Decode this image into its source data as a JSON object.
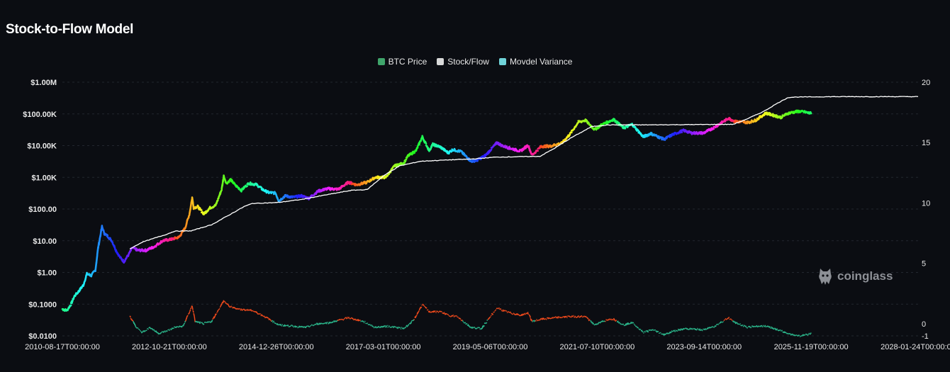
{
  "header": {
    "title": "Stock-to-Flow Model"
  },
  "legend": [
    {
      "label": "BTC Price",
      "color": "#3fa56b"
    },
    {
      "label": "Stock/Flow",
      "color": "#d9d9d9"
    },
    {
      "label": "Movdel Variance",
      "color": "#6fd3d8"
    }
  ],
  "watermark": {
    "text": "coinglass"
  },
  "chart_data": {
    "type": "line",
    "title": "Stock-to-Flow Model",
    "y_left": {
      "scale": "log",
      "ticks": [
        "$1.00M",
        "$100.00K",
        "$10.00K",
        "$1.00K",
        "$100.00",
        "$10.00",
        "$1.00",
        "$0.1000",
        "$0.0100"
      ],
      "range": [
        0.01,
        1000000
      ]
    },
    "y_right": {
      "ticks": [
        "20",
        "15",
        "10",
        "5",
        "0",
        "-1"
      ],
      "range": [
        -1,
        20
      ]
    },
    "x_ticks": [
      "2010-08-17T00:00:00",
      "2012-10-21T00:00:00",
      "2014-12-26T00:00:00",
      "2017-03-01T00:00:00",
      "2019-05-06T00:00:00",
      "2021-07-10T00:00:00",
      "2023-09-14T00:00:00",
      "2025-11-19T00:00:00",
      "2028-01-24T00:00:00"
    ],
    "x_range": [
      "2010-08-17",
      "2028-01-24"
    ],
    "grid": true,
    "legend_position": "top-center",
    "series": [
      {
        "name": "BTC Price",
        "axis": "left",
        "points": [
          [
            "2010-08-17",
            0.07
          ],
          [
            "2010-09-20",
            0.063
          ],
          [
            "2010-10-20",
            0.1
          ],
          [
            "2010-11-15",
            0.18
          ],
          [
            "2010-12-15",
            0.25
          ],
          [
            "2011-01-20",
            0.4
          ],
          [
            "2011-02-15",
            0.9
          ],
          [
            "2011-03-20",
            0.8
          ],
          [
            "2011-04-20",
            1.2
          ],
          [
            "2011-05-10",
            6
          ],
          [
            "2011-06-08",
            28
          ],
          [
            "2011-06-25",
            17
          ],
          [
            "2011-07-20",
            14
          ],
          [
            "2011-08-20",
            10
          ],
          [
            "2011-09-20",
            5
          ],
          [
            "2011-10-20",
            3
          ],
          [
            "2011-11-18",
            2.2
          ],
          [
            "2011-12-20",
            3.5
          ],
          [
            "2012-01-20",
            6
          ],
          [
            "2012-03-01",
            5
          ],
          [
            "2012-05-01",
            5
          ],
          [
            "2012-07-01",
            6.5
          ],
          [
            "2012-09-01",
            10
          ],
          [
            "2012-11-01",
            11
          ],
          [
            "2013-01-01",
            13
          ],
          [
            "2013-02-15",
            25
          ],
          [
            "2013-03-20",
            70
          ],
          [
            "2013-04-09",
            230
          ],
          [
            "2013-04-20",
            110
          ],
          [
            "2013-05-20",
            120
          ],
          [
            "2013-07-05",
            70
          ],
          [
            "2013-08-20",
            110
          ],
          [
            "2013-10-01",
            130
          ],
          [
            "2013-11-15",
            420
          ],
          [
            "2013-11-30",
            1100
          ],
          [
            "2013-12-20",
            650
          ],
          [
            "2014-01-20",
            850
          ],
          [
            "2014-02-25",
            560
          ],
          [
            "2014-04-10",
            390
          ],
          [
            "2014-06-05",
            650
          ],
          [
            "2014-08-01",
            590
          ],
          [
            "2014-09-20",
            400
          ],
          [
            "2014-11-01",
            330
          ],
          [
            "2014-12-20",
            320
          ],
          [
            "2015-01-14",
            180
          ],
          [
            "2015-03-01",
            260
          ],
          [
            "2015-05-01",
            235
          ],
          [
            "2015-07-01",
            260
          ],
          [
            "2015-08-25",
            220
          ],
          [
            "2015-11-05",
            370
          ],
          [
            "2016-01-10",
            440
          ],
          [
            "2016-04-01",
            420
          ],
          [
            "2016-06-15",
            700
          ],
          [
            "2016-08-15",
            580
          ],
          [
            "2016-11-01",
            700
          ],
          [
            "2017-01-01",
            1000
          ],
          [
            "2017-03-20",
            1000
          ],
          [
            "2017-05-25",
            2300
          ],
          [
            "2017-08-01",
            2800
          ],
          [
            "2017-09-01",
            4700
          ],
          [
            "2017-11-01",
            7000
          ],
          [
            "2017-12-17",
            19000
          ],
          [
            "2018-02-06",
            7000
          ],
          [
            "2018-03-05",
            11000
          ],
          [
            "2018-05-01",
            9000
          ],
          [
            "2018-06-28",
            5900
          ],
          [
            "2018-08-01",
            7500
          ],
          [
            "2018-10-01",
            6500
          ],
          [
            "2018-12-15",
            3200
          ],
          [
            "2019-02-01",
            3500
          ],
          [
            "2019-04-03",
            5000
          ],
          [
            "2019-06-26",
            12500
          ],
          [
            "2019-08-01",
            10000
          ],
          [
            "2019-10-01",
            8300
          ],
          [
            "2019-12-17",
            6700
          ],
          [
            "2020-02-12",
            10300
          ],
          [
            "2020-03-13",
            5000
          ],
          [
            "2020-05-20",
            9500
          ],
          [
            "2020-07-25",
            9600
          ],
          [
            "2020-10-20",
            12000
          ],
          [
            "2020-12-20",
            23000
          ],
          [
            "2021-02-20",
            55000
          ],
          [
            "2021-04-14",
            63000
          ],
          [
            "2021-06-22",
            32000
          ],
          [
            "2021-08-15",
            46000
          ],
          [
            "2021-11-10",
            67000
          ],
          [
            "2022-01-24",
            36000
          ],
          [
            "2022-03-28",
            47000
          ],
          [
            "2022-06-18",
            19000
          ],
          [
            "2022-08-14",
            24000
          ],
          [
            "2022-11-21",
            15800
          ],
          [
            "2023-01-20",
            22000
          ],
          [
            "2023-04-14",
            30000
          ],
          [
            "2023-06-15",
            25000
          ],
          [
            "2023-09-11",
            25000
          ],
          [
            "2023-12-01",
            38000
          ],
          [
            "2024-03-14",
            73000
          ],
          [
            "2024-05-01",
            58000
          ],
          [
            "2024-08-05",
            54000
          ],
          [
            "2024-10-01",
            63000
          ],
          [
            "2024-12-17",
            106000
          ],
          [
            "2025-04-07",
            78000
          ],
          [
            "2025-06-01",
            105000
          ],
          [
            "2025-08-14",
            121000
          ],
          [
            "2025-10-01",
            115000
          ],
          [
            "2025-11-10",
            105000
          ],
          [
            "2025-11-19",
            112000
          ]
        ]
      },
      {
        "name": "Stock/Flow",
        "axis": "left",
        "points": [
          [
            "2012-01-01",
            5.5
          ],
          [
            "2012-04-01",
            9
          ],
          [
            "2012-07-01",
            12
          ],
          [
            "2012-10-01",
            16
          ],
          [
            "2012-11-28",
            20
          ],
          [
            "2013-04-01",
            20.5
          ],
          [
            "2013-09-01",
            32
          ],
          [
            "2014-01-01",
            62
          ],
          [
            "2014-05-01",
            120
          ],
          [
            "2014-07-01",
            150
          ],
          [
            "2015-01-01",
            160
          ],
          [
            "2015-07-01",
            200
          ],
          [
            "2016-01-01",
            280
          ],
          [
            "2016-07-09",
            390
          ],
          [
            "2016-11-01",
            410
          ],
          [
            "2017-03-01",
            1100
          ],
          [
            "2017-07-01",
            2300
          ],
          [
            "2017-12-01",
            3200
          ],
          [
            "2018-06-01",
            3500
          ],
          [
            "2019-01-01",
            3800
          ],
          [
            "2019-06-01",
            4300
          ],
          [
            "2020-01-01",
            4500
          ],
          [
            "2020-05-11",
            4600
          ],
          [
            "2020-09-01",
            8500
          ],
          [
            "2021-01-01",
            18000
          ],
          [
            "2021-06-01",
            40000
          ],
          [
            "2021-10-01",
            45000
          ],
          [
            "2022-06-01",
            45000
          ],
          [
            "2023-06-01",
            46000
          ],
          [
            "2024-04-20",
            47000
          ],
          [
            "2024-08-01",
            70000
          ],
          [
            "2024-12-01",
            120000
          ],
          [
            "2025-03-15",
            220000
          ],
          [
            "2025-06-01",
            330000
          ],
          [
            "2025-08-01",
            340000
          ],
          [
            "2026-06-01",
            350000
          ],
          [
            "2028-01-24",
            350000
          ]
        ]
      },
      {
        "name": "Movdel Variance",
        "axis": "right",
        "points": [
          [
            "2012-01-01",
            0.6
          ],
          [
            "2012-02-20",
            -0.3
          ],
          [
            "2012-04-01",
            -0.7
          ],
          [
            "2012-06-01",
            -0.3
          ],
          [
            "2012-08-01",
            -0.8
          ],
          [
            "2012-10-01",
            -0.6
          ],
          [
            "2012-12-01",
            -0.3
          ],
          [
            "2013-02-01",
            -0.2
          ],
          [
            "2013-04-09",
            1.5
          ],
          [
            "2013-05-01",
            0.2
          ],
          [
            "2013-07-01",
            0.0
          ],
          [
            "2013-09-01",
            0.2
          ],
          [
            "2013-11-30",
            1.9
          ],
          [
            "2014-01-15",
            1.4
          ],
          [
            "2014-04-01",
            1.2
          ],
          [
            "2014-07-01",
            1.1
          ],
          [
            "2014-10-01",
            0.6
          ],
          [
            "2015-01-14",
            -0.1
          ],
          [
            "2015-05-01",
            -0.2
          ],
          [
            "2015-08-01",
            -0.3
          ],
          [
            "2015-11-01",
            0.0
          ],
          [
            "2016-02-01",
            0.1
          ],
          [
            "2016-06-15",
            0.5
          ],
          [
            "2016-10-01",
            0.2
          ],
          [
            "2017-01-01",
            -0.3
          ],
          [
            "2017-04-01",
            -0.2
          ],
          [
            "2017-08-01",
            -0.4
          ],
          [
            "2017-10-15",
            0.3
          ],
          [
            "2017-12-17",
            1.6
          ],
          [
            "2018-02-06",
            1.0
          ],
          [
            "2018-05-01",
            1.0
          ],
          [
            "2018-07-01",
            0.7
          ],
          [
            "2018-09-01",
            0.6
          ],
          [
            "2018-12-15",
            -0.3
          ],
          [
            "2019-03-01",
            -0.4
          ],
          [
            "2019-06-26",
            1.3
          ],
          [
            "2019-09-01",
            1.0
          ],
          [
            "2019-12-17",
            0.7
          ],
          [
            "2020-02-12",
            0.9
          ],
          [
            "2020-03-13",
            0.2
          ],
          [
            "2020-06-01",
            0.4
          ],
          [
            "2020-09-01",
            0.5
          ],
          [
            "2020-12-20",
            0.6
          ],
          [
            "2021-04-14",
            0.6
          ],
          [
            "2021-06-22",
            -0.1
          ],
          [
            "2021-08-15",
            0.2
          ],
          [
            "2021-11-10",
            0.4
          ],
          [
            "2022-01-24",
            -0.1
          ],
          [
            "2022-03-28",
            0.1
          ],
          [
            "2022-06-18",
            -0.7
          ],
          [
            "2022-09-01",
            -0.5
          ],
          [
            "2022-11-21",
            -0.9
          ],
          [
            "2023-02-01",
            -0.6
          ],
          [
            "2023-05-01",
            -0.4
          ],
          [
            "2023-09-11",
            -0.5
          ],
          [
            "2023-12-01",
            -0.2
          ],
          [
            "2024-03-14",
            0.5
          ],
          [
            "2024-05-01",
            0.1
          ],
          [
            "2024-08-05",
            -0.3
          ],
          [
            "2024-10-01",
            -0.2
          ],
          [
            "2025-01-01",
            -0.2
          ],
          [
            "2025-04-07",
            -0.6
          ],
          [
            "2025-07-01",
            -0.9
          ],
          [
            "2025-09-01",
            -1.0
          ],
          [
            "2025-11-19",
            -0.8
          ]
        ]
      }
    ]
  }
}
